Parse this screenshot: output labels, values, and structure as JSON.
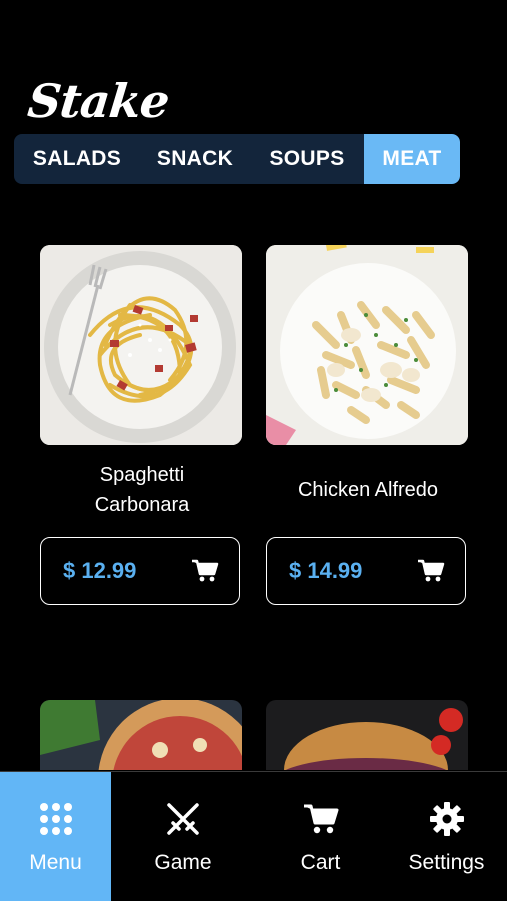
{
  "app": {
    "logo": "Stake"
  },
  "categories": [
    {
      "label": "SALADS",
      "active": false
    },
    {
      "label": "SNACK",
      "active": false
    },
    {
      "label": "SOUPS",
      "active": false
    },
    {
      "label": "MEAT",
      "active": true
    }
  ],
  "products": [
    {
      "name_line1": "Spaghetti",
      "name_line2": "Carbonara",
      "price": "$ 12.99",
      "cart_icon": "cart-icon"
    },
    {
      "name_line1": "Chicken Alfredo",
      "name_line2": "",
      "price": "$ 14.99",
      "cart_icon": "cart-icon"
    }
  ],
  "nav": [
    {
      "label": "Menu",
      "icon": "grid-icon",
      "active": true
    },
    {
      "label": "Game",
      "icon": "swords-icon",
      "active": false
    },
    {
      "label": "Cart",
      "icon": "cart-icon",
      "active": false
    },
    {
      "label": "Settings",
      "icon": "gear-icon",
      "active": false
    }
  ],
  "colors": {
    "accent": "#62b6f6",
    "price": "#5ab0f0",
    "tabs_bg": "#13253b",
    "background": "#000000"
  }
}
